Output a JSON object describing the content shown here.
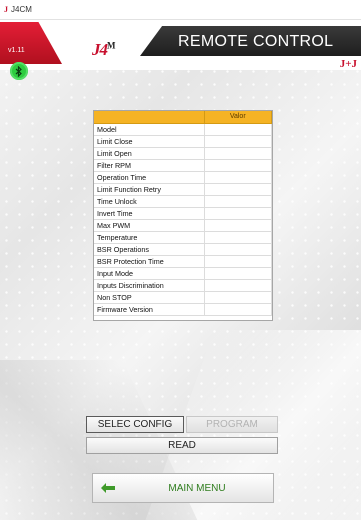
{
  "window": {
    "app_icon": "J",
    "title": "J4CM"
  },
  "header": {
    "version": "v1.11",
    "logo_text": "J4",
    "logo_sup": "M",
    "screen_title": "REMOTE CONTROL",
    "brand_small": "J+J",
    "bluetooth_icon": "bluetooth-icon",
    "bluetooth_color": "#2ecc40",
    "accent_red": "#c8102e"
  },
  "table": {
    "header_color": "#f5b324",
    "columns": [
      "",
      "Valor"
    ],
    "rows": [
      {
        "name": "Model",
        "value": ""
      },
      {
        "name": "Limit Close",
        "value": ""
      },
      {
        "name": "Limit Open",
        "value": ""
      },
      {
        "name": "Filter RPM",
        "value": ""
      },
      {
        "name": "Operation Time",
        "value": ""
      },
      {
        "name": "Limit Function Retry",
        "value": ""
      },
      {
        "name": "Time Unlock",
        "value": ""
      },
      {
        "name": "Invert Time",
        "value": ""
      },
      {
        "name": "Max PWM",
        "value": ""
      },
      {
        "name": "Temperature",
        "value": ""
      },
      {
        "name": "BSR Operations",
        "value": ""
      },
      {
        "name": "BSR Protection Time",
        "value": ""
      },
      {
        "name": "Input Mode",
        "value": ""
      },
      {
        "name": "Inputs Discrimination",
        "value": ""
      },
      {
        "name": "Non STOP",
        "value": ""
      },
      {
        "name": "Firmware Version",
        "value": ""
      }
    ]
  },
  "buttons": {
    "selec_config": "SELEC CONFIG",
    "program": "PROGRAM",
    "read": "READ",
    "main_menu": "MAIN MENU",
    "main_menu_icon": "back-arrow-icon",
    "main_menu_color": "#2f7d1e"
  }
}
